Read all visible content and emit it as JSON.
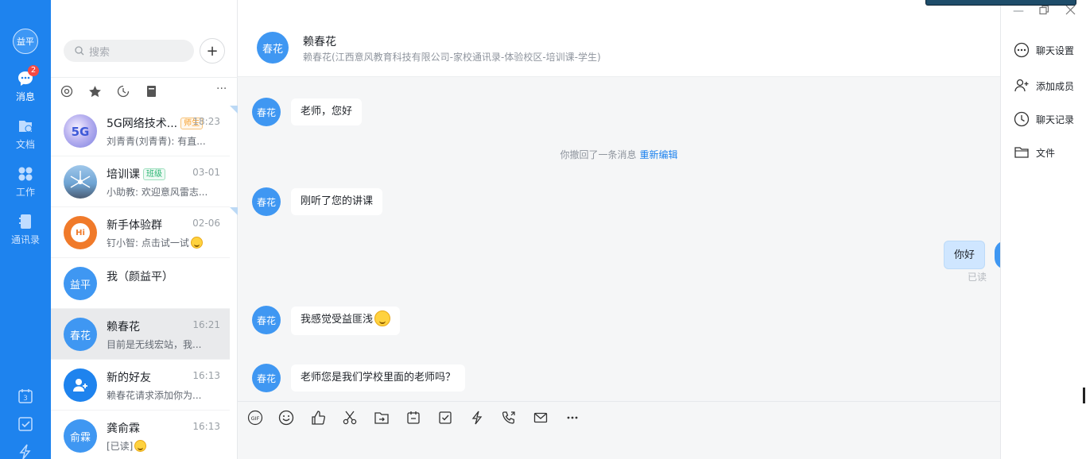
{
  "rail": {
    "me_label": "益平",
    "items": [
      {
        "label": "消息",
        "icon": "chat-bubble-icon",
        "badge": "2"
      },
      {
        "label": "文档",
        "icon": "document-icon"
      },
      {
        "label": "工作",
        "icon": "grid-apps-icon"
      },
      {
        "label": "通讯录",
        "icon": "contacts-book-icon"
      }
    ],
    "bottom_icons": [
      "calendar-icon",
      "task-check-icon",
      "lightning-icon"
    ],
    "calendar_day": "3"
  },
  "list": {
    "search_placeholder": "搜索",
    "add_label": "+",
    "filters": [
      "at-icon",
      "star-icon",
      "clock-icon",
      "bookmark-icon"
    ],
    "more_label": "···",
    "conversations": [
      {
        "avatar_text": "",
        "name": "5G网络技术...",
        "tag": "师生",
        "time": "18:23",
        "preview": "刘青青(刘青青): 有直..."
      },
      {
        "avatar_text": "",
        "name": "培训课",
        "tag": "班级",
        "time": "03-01",
        "preview": "小助教: 欢迎意风雷志..."
      },
      {
        "avatar_text": "Hi",
        "name": "新手体验群",
        "tag": "",
        "time": "02-06",
        "preview": "钉小智: 点击试一试"
      },
      {
        "avatar_text": "益平",
        "name": "我（颜益平）",
        "tag": "",
        "time": "",
        "preview": ""
      },
      {
        "avatar_text": "春花",
        "name": "赖春花",
        "tag": "",
        "time": "16:21",
        "preview": "目前是无线宏站，我..."
      },
      {
        "avatar_text": "",
        "name": "新的好友",
        "tag": "",
        "time": "16:13",
        "preview": "赖春花请求添加你为..."
      },
      {
        "avatar_text": "俞霖",
        "name": "龚俞霖",
        "tag": "",
        "time": "16:13",
        "preview": "[已读]"
      }
    ]
  },
  "chat": {
    "avatar_text": "春花",
    "title": "赖春花",
    "subtitle": "赖春花(江西意风教育科技有限公司-家校通讯录-体验校区-培训课-学生)",
    "messages": [
      {
        "from": "春花",
        "text": "老师，您好"
      },
      {
        "from": "春花",
        "text": "刚听了您的讲课"
      },
      {
        "from": "春花",
        "text": "我感觉受益匪浅"
      },
      {
        "from": "春花",
        "text": "老师您是我们学校里面的老师吗？"
      }
    ],
    "recall_text": "你撤回了一条消息",
    "recall_link": "重新编辑",
    "my_message": "你好",
    "read_status": "已读",
    "toolbar_gif": "GIF"
  },
  "side": {
    "items": [
      {
        "label": "聊天设置",
        "icon": "more-circle-icon"
      },
      {
        "label": "添加成员",
        "icon": "add-member-icon"
      },
      {
        "label": "聊天记录",
        "icon": "history-clock-icon"
      },
      {
        "label": "文件",
        "icon": "folder-icon"
      }
    ]
  },
  "colors": {
    "brand": "#1e83ee",
    "avatar": "#3f97f2",
    "badge": "#f54a45",
    "bubble_mine": "#cfe6ff"
  }
}
